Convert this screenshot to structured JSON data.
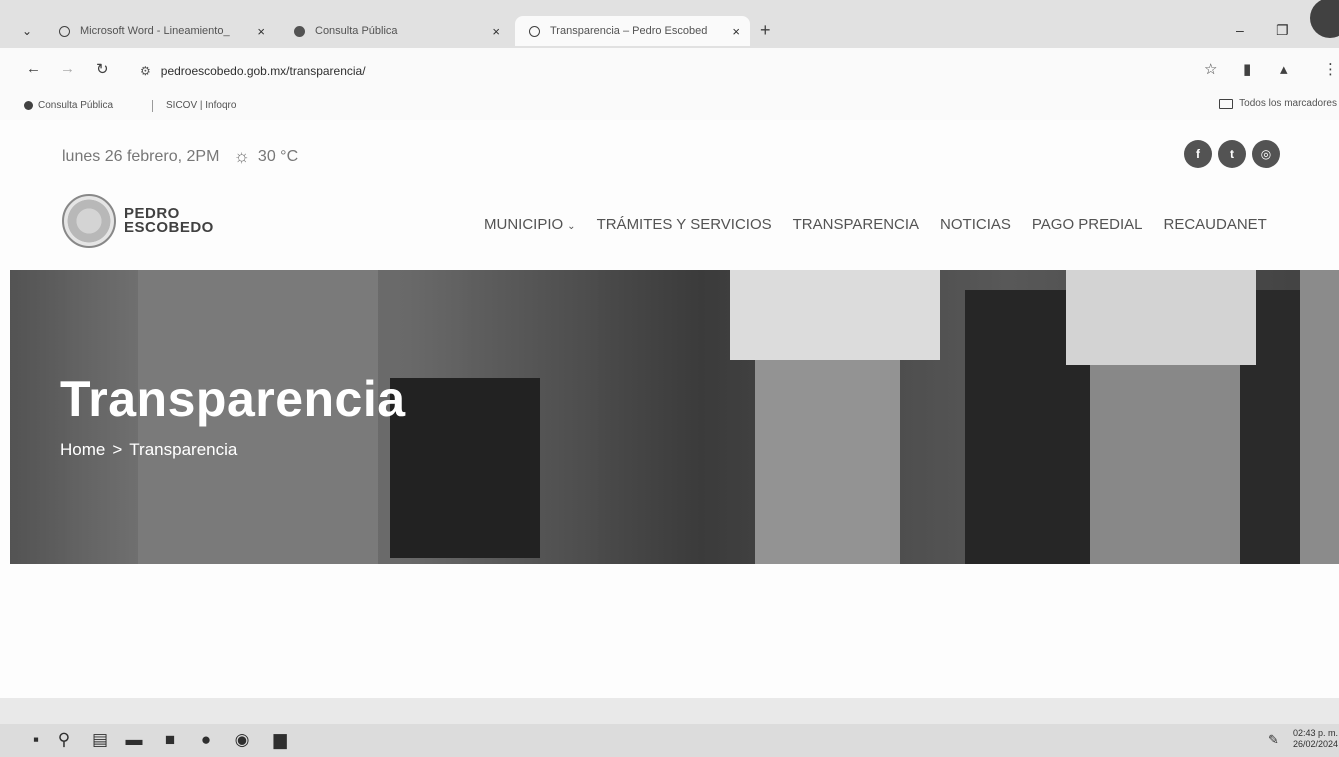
{
  "browser": {
    "tabs": [
      {
        "title": "Microsoft Word - Lineamiento_",
        "close": "×"
      },
      {
        "title": "Consulta Pública",
        "close": "×"
      },
      {
        "title": "Transparencia – Pedro Escobed",
        "close": "×"
      }
    ],
    "new_tab": "+",
    "minimize": "–",
    "restore": "❐",
    "url": "pedroescobedo.gob.mx/transparencia/",
    "bookmarks": [
      "Consulta Pública",
      "SICOV | Infoqro"
    ],
    "all_bookmarks": "Todos los marcadores"
  },
  "site": {
    "date_text": "lunes 26 febrero, 2PM",
    "temperature": "30 °C",
    "socials": [
      "facebook-icon",
      "twitter-icon",
      "instagram-icon"
    ],
    "logo": {
      "line1": "PEDRO",
      "line2": "ESCOBEDO"
    },
    "nav": [
      {
        "label": "MUNICIPIO",
        "has_dropdown": true
      },
      {
        "label": "TRÁMITES Y SERVICIOS"
      },
      {
        "label": "TRANSPARENCIA"
      },
      {
        "label": "NOTICIAS"
      },
      {
        "label": "PAGO PREDIAL"
      },
      {
        "label": "RECAUDANET"
      }
    ],
    "hero": {
      "title": "Transparencia",
      "breadcrumb_home": "Home",
      "breadcrumb_sep": ">",
      "breadcrumb_current": "Transparencia"
    }
  },
  "taskbar": {
    "time": "02:43 p. m.",
    "date": "26/02/2024"
  }
}
